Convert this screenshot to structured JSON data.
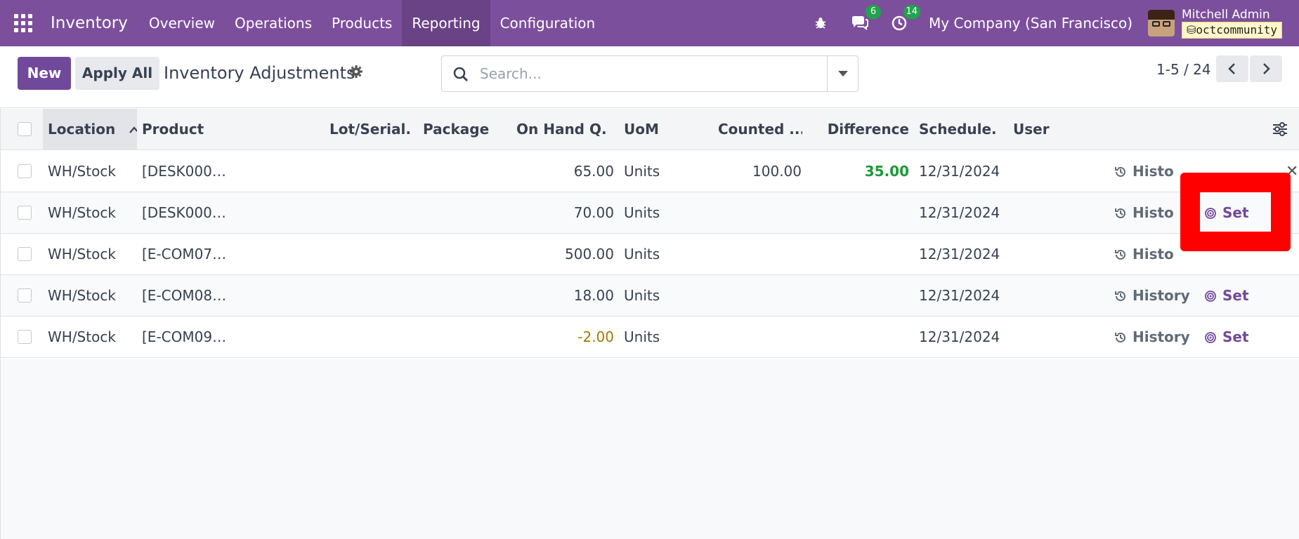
{
  "navbar": {
    "app_name": "Inventory",
    "menu": [
      "Overview",
      "Operations",
      "Products",
      "Reporting",
      "Configuration"
    ],
    "active_menu": "Reporting",
    "messages_count": "6",
    "activities_count": "14",
    "company": "My Company (San Francisco)",
    "user_name": "Mitchell Admin",
    "db_name": "octcommunity",
    "accent_color": "#7c4f9c"
  },
  "control": {
    "new_label": "New",
    "apply_all_label": "Apply All",
    "title": "Inventory Adjustments",
    "search_placeholder": "Search...",
    "pager": "1-5 / 24"
  },
  "table": {
    "columns": [
      "Location",
      "Product",
      "Lot/Serial...",
      "Package",
      "On Hand Q...",
      "UoM",
      "Counted ...",
      "Difference",
      "Schedule...",
      "User"
    ],
    "sorted_column": "Location",
    "history_label": "History",
    "set_label": "Set",
    "rows": [
      {
        "location": "WH/Stock",
        "product": "[DESK000…",
        "on_hand": "65.00",
        "uom": "Units",
        "counted": "100.00",
        "difference": "35.00",
        "scheduled": "12/31/2024",
        "history": "Histo",
        "has_set": false
      },
      {
        "location": "WH/Stock",
        "product": "[DESK000…",
        "on_hand": "70.00",
        "uom": "Units",
        "counted": "",
        "difference": "",
        "scheduled": "12/31/2024",
        "history": "Histo",
        "has_set": true
      },
      {
        "location": "WH/Stock",
        "product": "[E-COM07…",
        "on_hand": "500.00",
        "uom": "Units",
        "counted": "",
        "difference": "",
        "scheduled": "12/31/2024",
        "history": "Histo",
        "has_set": false
      },
      {
        "location": "WH/Stock",
        "product": "[E-COM08…",
        "on_hand": "18.00",
        "uom": "Units",
        "counted": "",
        "difference": "",
        "scheduled": "12/31/2024",
        "history": "History",
        "has_set": true
      },
      {
        "location": "WH/Stock",
        "product": "[E-COM09…",
        "on_hand": "-2.00",
        "uom": "Units",
        "counted": "",
        "difference": "",
        "scheduled": "12/31/2024",
        "history": "History",
        "has_set": true
      }
    ]
  },
  "colors": {
    "positive": "#1c9a36",
    "negative": "#a07a00",
    "highlight": "#ff0000"
  }
}
